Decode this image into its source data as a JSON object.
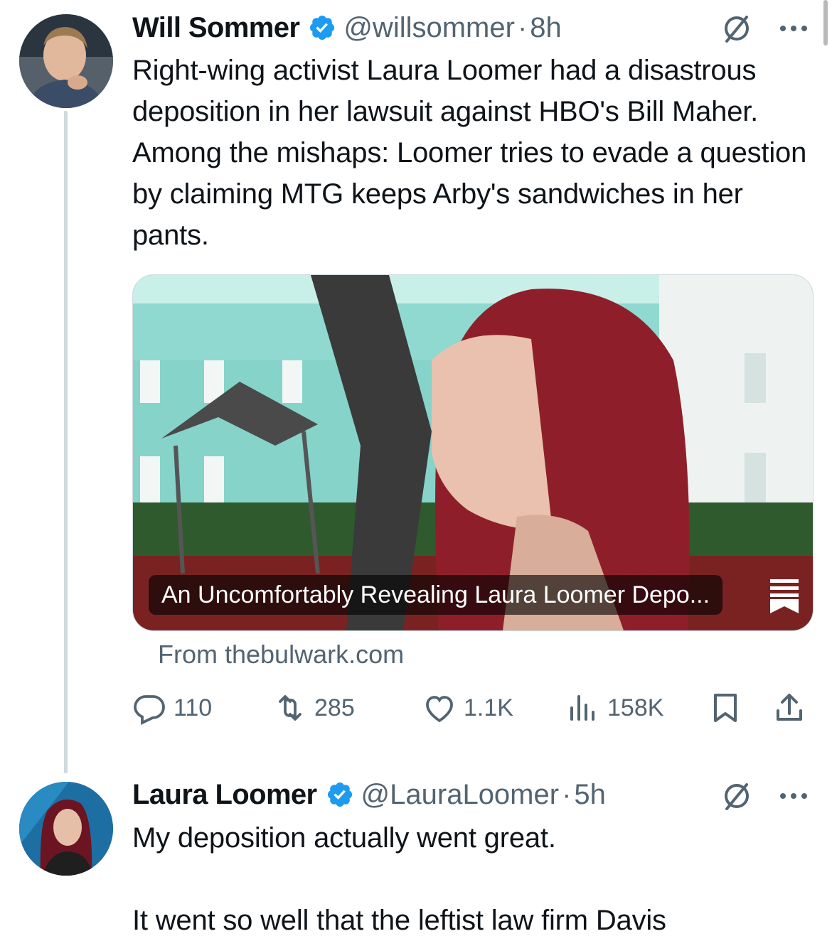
{
  "tweet1": {
    "author_name": "Will Sommer",
    "handle": "@willsommer",
    "separator": "·",
    "time": "8h",
    "text": "Right-wing activist Laura Loomer had a disastrous deposition in her lawsuit against HBO's Bill Maher. Among the mishaps: Loomer tries to evade a question by claiming MTG keeps Arby's sandwiches in her pants.",
    "card": {
      "title": "An Uncomfortably Revealing Laura Loomer Depo...",
      "source": "From thebulwark.com"
    },
    "stats": {
      "replies": "110",
      "reposts": "285",
      "likes": "1.1K",
      "views": "158K"
    }
  },
  "tweet2": {
    "author_name": "Laura Loomer",
    "handle": "@LauraLoomer",
    "separator": "·",
    "time": "5h",
    "text_line1": "My deposition actually went great.",
    "text_line2": "It went so well that the leftist law firm Davis"
  },
  "colors": {
    "text_primary": "#0f1419",
    "text_secondary": "#536471",
    "verified_blue": "#1d9bf0",
    "thread_line": "#cfd9de"
  },
  "icons": [
    "verified-badge-icon",
    "grok-icon",
    "more-icon",
    "reply-icon",
    "repost-icon",
    "like-icon",
    "views-icon",
    "bookmark-icon",
    "share-icon",
    "bulwark-logo-icon"
  ]
}
